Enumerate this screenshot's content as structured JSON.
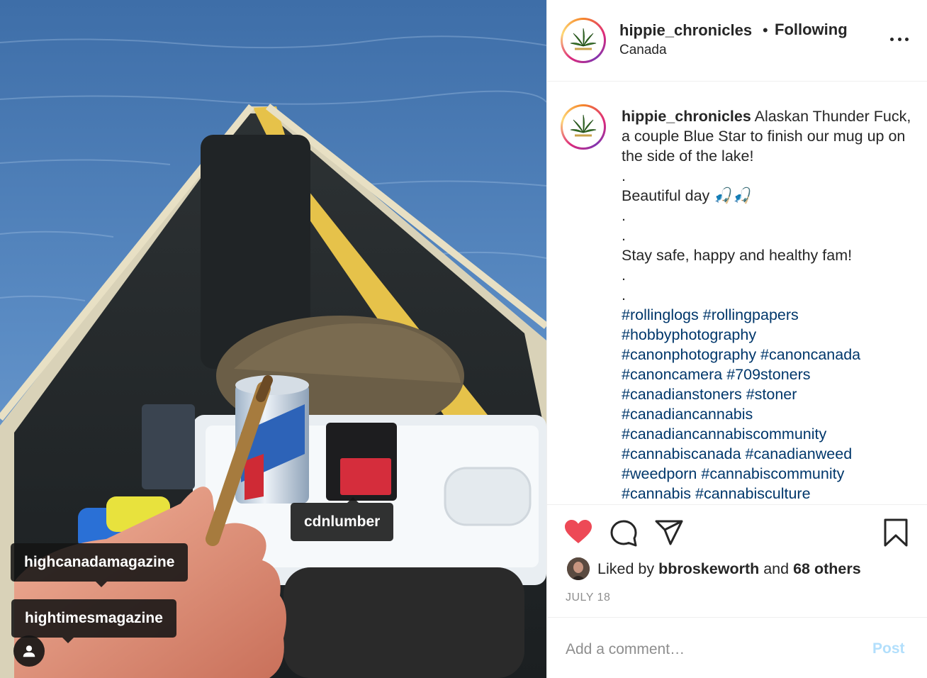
{
  "post": {
    "username": "hippie_chronicles",
    "follow_status": "Following",
    "separator": "•",
    "location": "Canada",
    "more_icon": "more-horizontal-icon"
  },
  "photo": {
    "tags": [
      {
        "username": "cdnlumber"
      },
      {
        "username": "highcanadamagazine"
      },
      {
        "username": "hightimesmagazine"
      }
    ],
    "user_tag_icon": "person-icon"
  },
  "caption": {
    "username": "hippie_chronicles",
    "text_first": " Alaskan Thunder Fuck, a couple Blue Star to finish our mug up on the side of the lake!",
    "dot": ".",
    "line_beautiful": "Beautiful day 🎣🎣",
    "line_stay_safe": "Stay safe, happy and healthy fam!",
    "hashtags": [
      "#rollinglogs #rollingpapers",
      "#hobbyphotography",
      "#canonphotography #canoncanada",
      "#canoncamera #709stoners",
      "#canadianstoners #stoner",
      "#canadiancannabis",
      "#canadiancannabiscommunity",
      "#cannabiscanada #canadianweed",
      "#weedporn #cannabiscommunity",
      "#cannabis #cannabisculture"
    ]
  },
  "actions": {
    "like_icon": "heart-filled-icon",
    "comment_icon": "comment-icon",
    "share_icon": "share-icon",
    "save_icon": "bookmark-icon",
    "like_color": "#ed4956"
  },
  "likes": {
    "prefix": "Liked by",
    "user": "bbroskeworth",
    "middle": "and",
    "others": "68 others"
  },
  "date": "JULY 18",
  "comment": {
    "placeholder": "Add a comment…",
    "post_label": "Post",
    "post_color": "#b2dffc"
  }
}
